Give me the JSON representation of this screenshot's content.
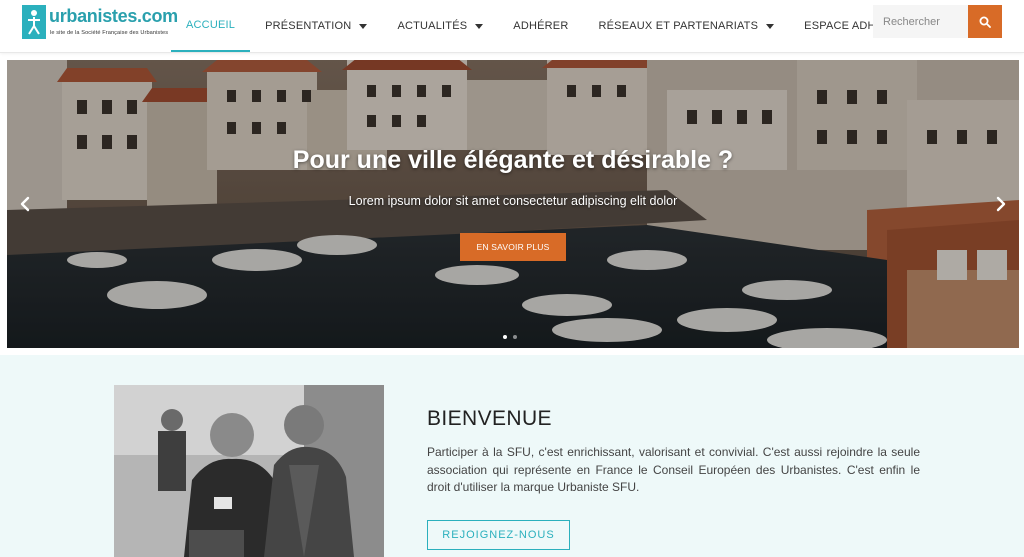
{
  "logo": {
    "brand": "urbanistes.com",
    "tagline": "le site de la Société Française des Urbanistes"
  },
  "nav": {
    "items": [
      {
        "label": "ACCUEIL",
        "active": true,
        "dropdown": false
      },
      {
        "label": "PRÉSENTATION",
        "active": false,
        "dropdown": true
      },
      {
        "label": "ACTUALITÉS",
        "active": false,
        "dropdown": true
      },
      {
        "label": "ADHÉRER",
        "active": false,
        "dropdown": false
      },
      {
        "label": "RÉSEAUX ET PARTENARIATS",
        "active": false,
        "dropdown": true
      },
      {
        "label": "ESPACE ADHÉRENT",
        "active": false,
        "dropdown": true
      }
    ]
  },
  "search": {
    "placeholder": "Rechercher",
    "icon": "search-icon"
  },
  "hero": {
    "title": "Pour une ville élégante et désirable ?",
    "subtitle": "Lorem ipsum dolor sit amet consectetur adipiscing elit dolor",
    "button_label": "EN SAVOIR PLUS",
    "prev_icon": "chevron-left-icon",
    "next_icon": "chevron-right-icon",
    "slide_count": 2,
    "active_slide": 1
  },
  "welcome": {
    "title": "BIENVENUE",
    "text": "Participer à la SFU, c'est enrichissant, valorisant et convivial. C'est aussi rejoindre la seule association qui représente en France le Conseil Européen des Urbanistes. C'est enfin le droit d'utiliser la marque Urbaniste SFU.",
    "button_label": "REJOIGNEZ-NOUS"
  },
  "colors": {
    "accent_teal": "#2bb0bd",
    "accent_orange": "#d86b27",
    "section_bg": "#eef9f9"
  }
}
